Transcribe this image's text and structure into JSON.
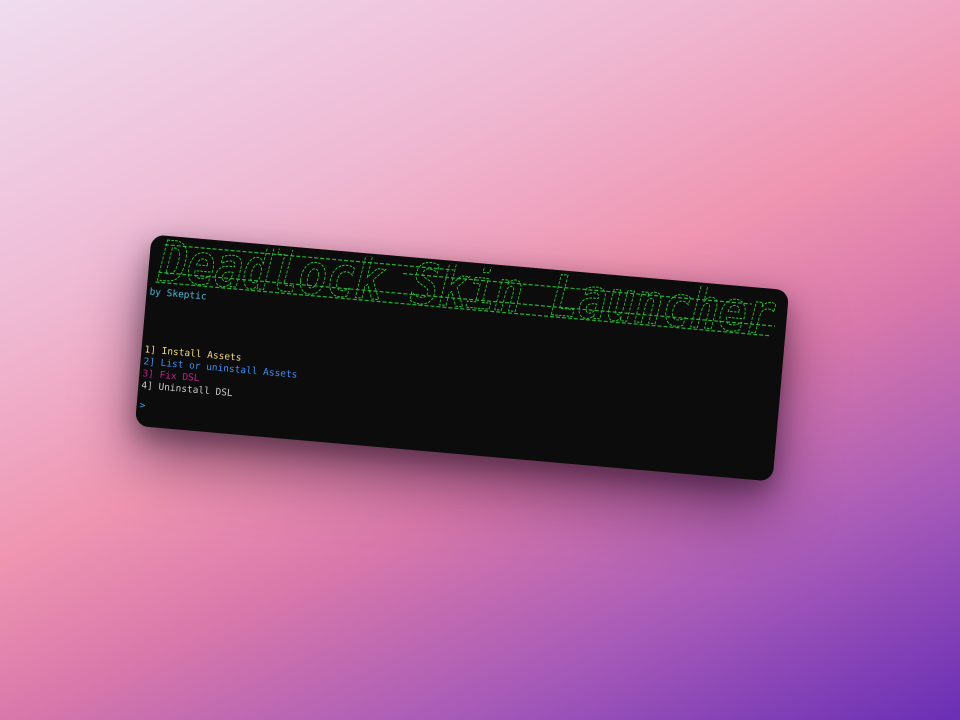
{
  "terminal": {
    "banner_text": "Deadlock Skin Launcher",
    "author": "by Skeptic",
    "menu": [
      {
        "number": "1]",
        "label": "Install Assets"
      },
      {
        "number": "2]",
        "label": "List or uninstall Assets"
      },
      {
        "number": "3]",
        "label": "Fix DSL"
      },
      {
        "number": "4]",
        "label": "Uninstall DSL"
      }
    ],
    "prompt": ">"
  },
  "colors": {
    "terminal_bg": "#0c0c0c",
    "banner": "#27c23a",
    "author": "#4ab8d8",
    "menu_1": "#f2d78c",
    "menu_2": "#3e8ef0",
    "menu_3": "#c2208c",
    "menu_4": "#c8c8c8",
    "prompt": "#3aa8d8"
  }
}
